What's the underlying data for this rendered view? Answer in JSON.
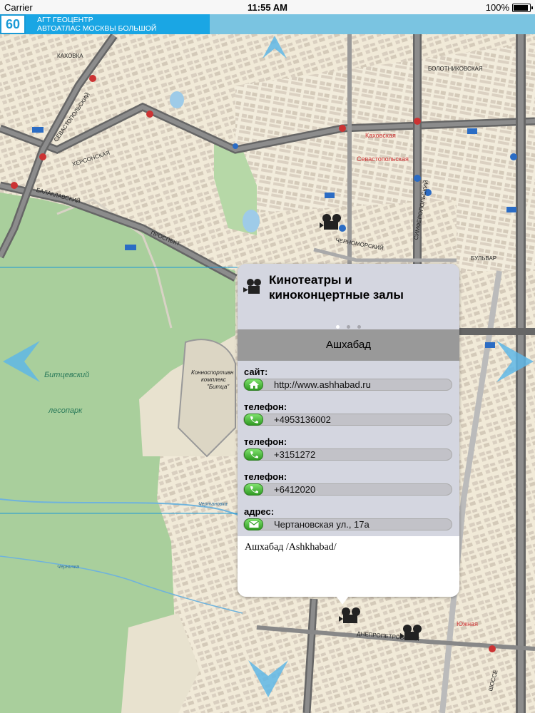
{
  "status_bar": {
    "carrier": "Carrier",
    "time": "11:55 AM",
    "battery": "100%"
  },
  "page_header": {
    "page_number": "60",
    "line1": "АГТ ГЕОЦЕНТР",
    "line2": "АВТОАТЛАС МОСКВЫ БОЛЬШОЙ"
  },
  "map_labels": {
    "forest1": "Битцевский",
    "forest2": "лесопарк",
    "sport1": "Конноспортивн",
    "sport2": "комплекс",
    "sport3": "\"Битца\"",
    "river1": "Чертановка",
    "river2": "Черничка",
    "street_kakhovka": "КАХОВКА",
    "street_sevastopolsky": "СЕВАСТОПОЛЬСКИЙ",
    "street_prospekt": "ПРОСПЕКТ",
    "street_balaklavsky": "БАЛАКЛАВСКИЙ",
    "street_khersonskaya": "ХЕРСОНСКАЯ",
    "street_simferopolsky": "СИМФЕРОПОЛЬСКИЙ",
    "street_chernomorsky": "ЧЕРНОМОРСКИЙ",
    "street_bulvar": "БУЛЬВАР",
    "metro_kakhovskaya": "Каховская",
    "metro_sevastopolskaya": "Севастопольская",
    "street_bolotnikovskaya": "БОЛОТНИКОВСКАЯ",
    "street_dnepropetrovsky": "ДНЕПРОПЕТРОВСКИЙ",
    "metro_yuzhnaya": "Южная",
    "street_shosse": "ШОССЕ"
  },
  "popup": {
    "category_icon": "film-camera-icon",
    "category_title": "Кинотеатры и киноконцертные залы",
    "page_dots": 3,
    "active_dot": 0,
    "name": "Ашхабад",
    "fields": [
      {
        "label": "сайт:",
        "icon": "home-icon",
        "value": "http://www.ashhabad.ru"
      },
      {
        "label": "телефон:",
        "icon": "phone-icon",
        "value": "+4953136002"
      },
      {
        "label": "телефон:",
        "icon": "phone-icon",
        "value": "+3151272"
      },
      {
        "label": "телефон:",
        "icon": "phone-icon",
        "value": "+6412020"
      },
      {
        "label": "адрес:",
        "icon": "mail-icon",
        "value": "Чертановская ул., 17а"
      }
    ],
    "description": "Ашхабад /Ashkhabad/"
  },
  "colors": {
    "accent": "#1aa6e4",
    "popup_bg": "#d4d6e0",
    "name_bar": "#999999",
    "button_green": "#3aab2c"
  }
}
